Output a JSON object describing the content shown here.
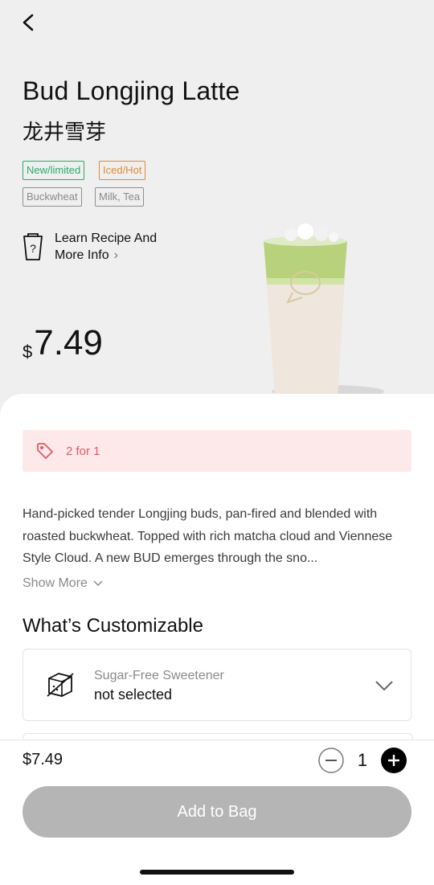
{
  "header": {
    "back_icon": "chevron-left-icon",
    "title": "Bud Longjing Latte",
    "subtitle": "龙井雪芽"
  },
  "tags": [
    {
      "label": "New/limited",
      "color": "#2fa86a"
    },
    {
      "label": "Iced/Hot",
      "color": "#e08a3a"
    },
    {
      "label": "Buckwheat",
      "color": "#8a8a8a"
    },
    {
      "label": "Milk, Tea",
      "color": "#8a8a8a"
    }
  ],
  "recipe": {
    "icon": "cup-question-icon",
    "line1": "Learn Recipe And",
    "line2": "More Info",
    "chevron": "›"
  },
  "price": {
    "currency": "$",
    "amount": "7.49"
  },
  "promo": {
    "icon": "tag-icon",
    "text": "2 for 1",
    "bg_color": "#fde9ea",
    "text_color": "#e05a67"
  },
  "description": {
    "text": "Hand-picked tender Longjing buds, pan-fired and blended with roasted buckwheat. Topped with rich matcha cloud and Viennese Style Cloud. A new BUD emerges through the sno...",
    "show_more": "Show More"
  },
  "customizable": {
    "title": "What’s Customizable",
    "items": [
      {
        "icon": "sugar-cube-slash-icon",
        "label": "Sugar-Free Sweetener",
        "value": "not selected"
      }
    ]
  },
  "bottom": {
    "price": "$7.49",
    "quantity": "1",
    "add_to_bag": "Add to Bag",
    "button_color": "#b5b5b5"
  }
}
